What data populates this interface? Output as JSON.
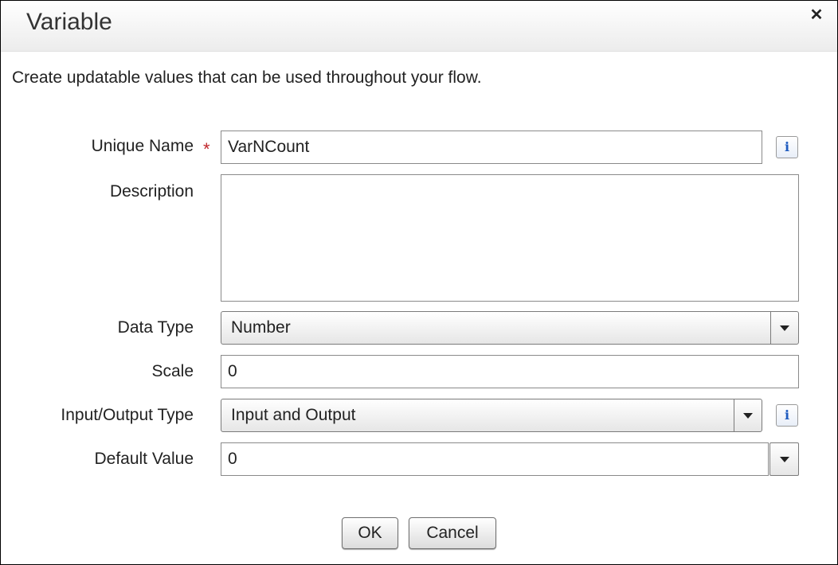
{
  "dialog": {
    "title": "Variable",
    "description": "Create updatable values that can be used throughout your flow."
  },
  "form": {
    "unique_name": {
      "label": "Unique Name",
      "required_marker": "*",
      "value": "VarNCount"
    },
    "description": {
      "label": "Description",
      "value": ""
    },
    "data_type": {
      "label": "Data Type",
      "value": "Number"
    },
    "scale": {
      "label": "Scale",
      "value": "0"
    },
    "io_type": {
      "label": "Input/Output Type",
      "value": "Input and Output"
    },
    "default_value": {
      "label": "Default Value",
      "value": "0"
    }
  },
  "icons": {
    "close": "close-icon",
    "info": "info-icon",
    "dropdown": "chevron-down-icon"
  },
  "info_glyph": "i",
  "buttons": {
    "ok": "OK",
    "cancel": "Cancel"
  },
  "colors": {
    "required": "#c0262b",
    "info": "#1e5bbf"
  }
}
